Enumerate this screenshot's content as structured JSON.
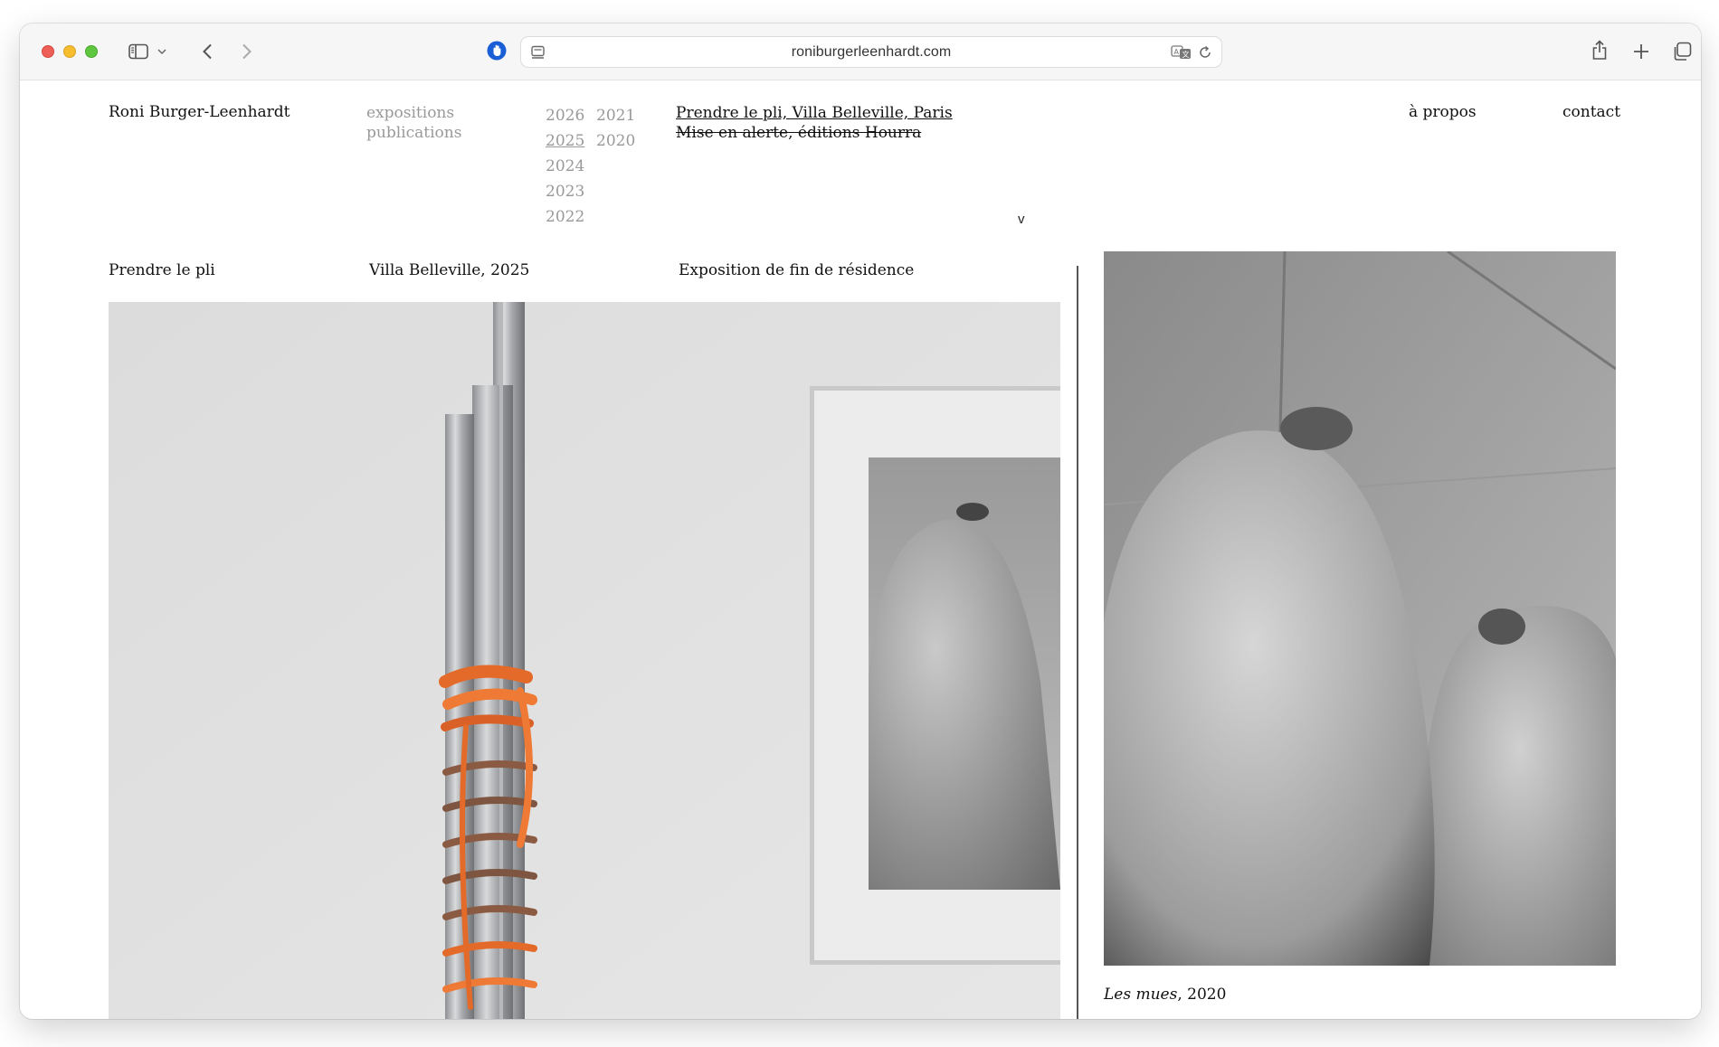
{
  "browser": {
    "url": "roniburgerleenhardt.com"
  },
  "site": {
    "title": "Roni Burger-Leenhardt",
    "nav": {
      "categories": [
        "expositions",
        "publications"
      ],
      "years_col1": [
        "2026",
        "2025",
        "2024",
        "2023",
        "2022"
      ],
      "years_col2": [
        "2021",
        "2020"
      ],
      "selected_year": "2025",
      "items": [
        "Prendre le pli, Villa Belleville, Paris",
        "Mise en alerte, éditions Hourra"
      ],
      "expand_glyph": "v",
      "about": "à propos",
      "contact": "contact"
    }
  },
  "exhibition": {
    "title": "Prendre le pli",
    "place": "Villa Belleville, 2025",
    "description": "Exposition de fin de résidence"
  },
  "side_caption": {
    "title": "Les mues",
    "year": ", 2020"
  },
  "colors": {
    "toolbar_bg": "#f6f6f6",
    "traffic_red": "#ee5f57",
    "traffic_yellow": "#f6be2f",
    "traffic_green": "#5fc63f",
    "nav_muted": "#999999",
    "privacy_blue": "#1a5fd6"
  },
  "icons": [
    "sidebar-icon",
    "chevron-down-icon",
    "back-icon",
    "forward-icon",
    "privacy-shield-icon",
    "page-settings-icon",
    "translate-icon",
    "reload-icon",
    "share-icon",
    "new-tab-icon",
    "tabs-overview-icon"
  ]
}
